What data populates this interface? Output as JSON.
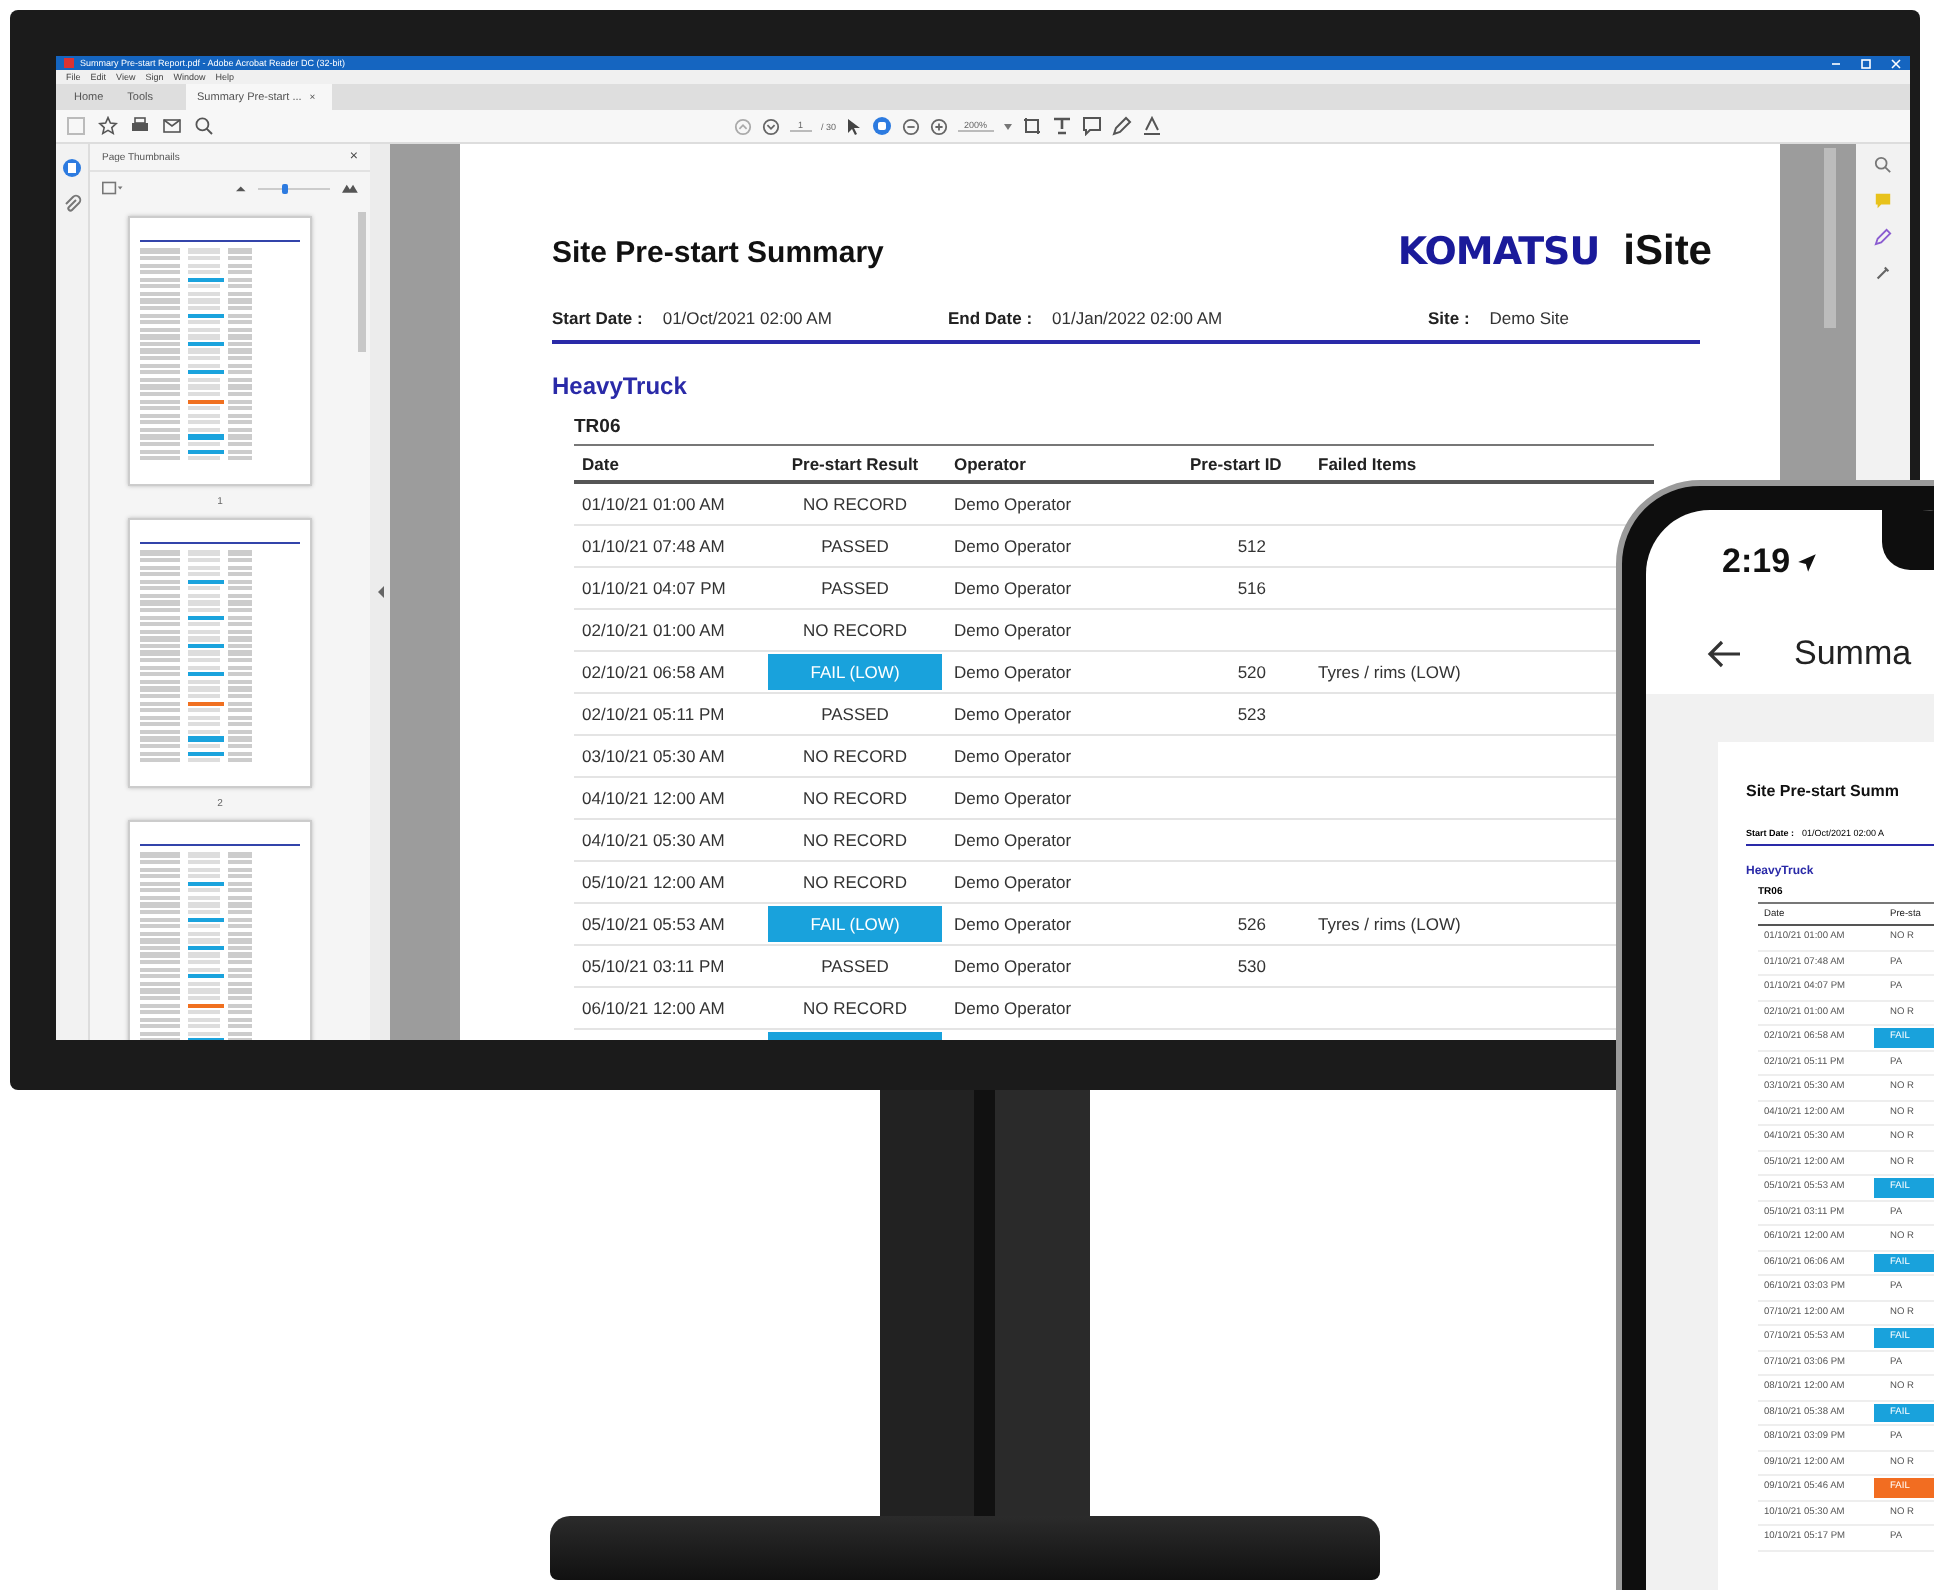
{
  "window": {
    "title": "Summary Pre-start Report.pdf - Adobe Acrobat Reader DC (32-bit)"
  },
  "menu": [
    "File",
    "Edit",
    "View",
    "Sign",
    "Window",
    "Help"
  ],
  "tabs": [
    {
      "label": "Home",
      "selected": false
    },
    {
      "label": "Tools",
      "selected": false
    },
    {
      "label": "Summary Pre-start ...",
      "selected": true,
      "close": "×"
    }
  ],
  "toolbar": {
    "page": "1",
    "page_count": "/ 30",
    "zoom": "200%"
  },
  "thumbnails_panel": {
    "title": "Page Thumbnails",
    "close": "×",
    "level": 0.33,
    "pages": [
      {
        "label": "1"
      },
      {
        "label": "2"
      },
      {
        "cut_off": true
      }
    ]
  },
  "report": {
    "title": "Site Pre-start Summary",
    "logo": {
      "brand": "KOMATSU",
      "product": "iSite"
    },
    "meta": [
      {
        "label": "Start Date :",
        "value": "01/Oct/2021 02:00 AM"
      },
      {
        "label": "End Date :",
        "value": "01/Jan/2022 02:00 AM"
      },
      {
        "label": "Site :",
        "value": "Demo Site"
      }
    ],
    "group": "HeavyTruck",
    "unit": "TR06",
    "columns": [
      "Date",
      "Pre-start Result",
      "Operator",
      "Pre-start ID",
      "Failed Items"
    ],
    "rows": [
      {
        "date": "01/10/21 01:00 AM",
        "result": "NO RECORD",
        "kind": "none",
        "operator": "Demo Operator"
      },
      {
        "date": "01/10/21 07:48 AM",
        "result": "PASSED",
        "kind": "pass",
        "operator": "Demo Operator",
        "id": "512"
      },
      {
        "date": "01/10/21 04:07 PM",
        "result": "PASSED",
        "kind": "pass",
        "operator": "Demo Operator",
        "id": "516"
      },
      {
        "date": "02/10/21 01:00 AM",
        "result": "NO RECORD",
        "kind": "none",
        "operator": "Demo Operator"
      },
      {
        "date": "02/10/21 06:58 AM",
        "result": "FAIL (LOW)",
        "kind": "fail_low",
        "operator": "Demo Operator",
        "id": "520",
        "failed": "Tyres / rims (LOW)"
      },
      {
        "date": "02/10/21 05:11 PM",
        "result": "PASSED",
        "kind": "pass",
        "operator": "Demo Operator",
        "id": "523"
      },
      {
        "date": "03/10/21 05:30 AM",
        "result": "NO RECORD",
        "kind": "none",
        "operator": "Demo Operator"
      },
      {
        "date": "04/10/21 12:00 AM",
        "result": "NO RECORD",
        "kind": "none",
        "operator": "Demo Operator"
      },
      {
        "date": "04/10/21 05:30 AM",
        "result": "NO RECORD",
        "kind": "none",
        "operator": "Demo Operator"
      },
      {
        "date": "05/10/21 12:00 AM",
        "result": "NO RECORD",
        "kind": "none",
        "operator": "Demo Operator"
      },
      {
        "date": "05/10/21 05:53 AM",
        "result": "FAIL (LOW)",
        "kind": "fail_low",
        "operator": "Demo Operator",
        "id": "526",
        "failed": "Tyres / rims (LOW)"
      },
      {
        "date": "05/10/21 03:11 PM",
        "result": "PASSED",
        "kind": "pass",
        "operator": "Demo Operator",
        "id": "530"
      },
      {
        "date": "06/10/21 12:00 AM",
        "result": "NO RECORD",
        "kind": "none",
        "operator": "Demo Operator"
      }
    ]
  },
  "phone": {
    "time": "2:19",
    "nav_title": "Summa",
    "report": {
      "title": "Site Pre-start Summ",
      "meta_label": "Start Date :",
      "meta_value": "01/Oct/2021 02:00 A",
      "group": "HeavyTruck",
      "unit": "TR06",
      "columns": [
        "Date",
        "Pre-sta"
      ],
      "rows": [
        {
          "date": "01/10/21 01:00 AM",
          "result": "NO R",
          "kind": "none"
        },
        {
          "date": "01/10/21 07:48 AM",
          "result": "PA",
          "kind": "pass"
        },
        {
          "date": "01/10/21 04:07 PM",
          "result": "PA",
          "kind": "pass"
        },
        {
          "date": "02/10/21 01:00 AM",
          "result": "NO R",
          "kind": "none"
        },
        {
          "date": "02/10/21 06:58 AM",
          "result": "FAIL",
          "kind": "fail_low"
        },
        {
          "date": "02/10/21 05:11 PM",
          "result": "PA",
          "kind": "pass"
        },
        {
          "date": "03/10/21 05:30 AM",
          "result": "NO R",
          "kind": "none"
        },
        {
          "date": "04/10/21 12:00 AM",
          "result": "NO R",
          "kind": "none"
        },
        {
          "date": "04/10/21 05:30 AM",
          "result": "NO R",
          "kind": "none"
        },
        {
          "date": "05/10/21 12:00 AM",
          "result": "NO R",
          "kind": "none"
        },
        {
          "date": "05/10/21 05:53 AM",
          "result": "FAIL",
          "kind": "fail_low"
        },
        {
          "date": "05/10/21 03:11 PM",
          "result": "PA",
          "kind": "pass"
        },
        {
          "date": "06/10/21 12:00 AM",
          "result": "NO R",
          "kind": "none"
        },
        {
          "date": "06/10/21 06:06 AM",
          "result": "FAIL",
          "kind": "fail_low"
        },
        {
          "date": "06/10/21 03:03 PM",
          "result": "PA",
          "kind": "pass"
        },
        {
          "date": "07/10/21 12:00 AM",
          "result": "NO R",
          "kind": "none"
        },
        {
          "date": "07/10/21 05:53 AM",
          "result": "FAIL",
          "kind": "fail_low"
        },
        {
          "date": "07/10/21 03:06 PM",
          "result": "PA",
          "kind": "pass"
        },
        {
          "date": "08/10/21 12:00 AM",
          "result": "NO R",
          "kind": "none"
        },
        {
          "date": "08/10/21 05:38 AM",
          "result": "FAIL",
          "kind": "fail_low"
        },
        {
          "date": "08/10/21 03:09 PM",
          "result": "PA",
          "kind": "pass"
        },
        {
          "date": "09/10/21 12:00 AM",
          "result": "NO R",
          "kind": "none"
        },
        {
          "date": "09/10/21 05:46 AM",
          "result": "FAIL",
          "kind": "fail_high"
        },
        {
          "date": "10/10/21 05:30 AM",
          "result": "NO R",
          "kind": "none"
        },
        {
          "date": "10/10/21 05:17 PM",
          "result": "PA",
          "kind": "pass"
        }
      ]
    }
  }
}
